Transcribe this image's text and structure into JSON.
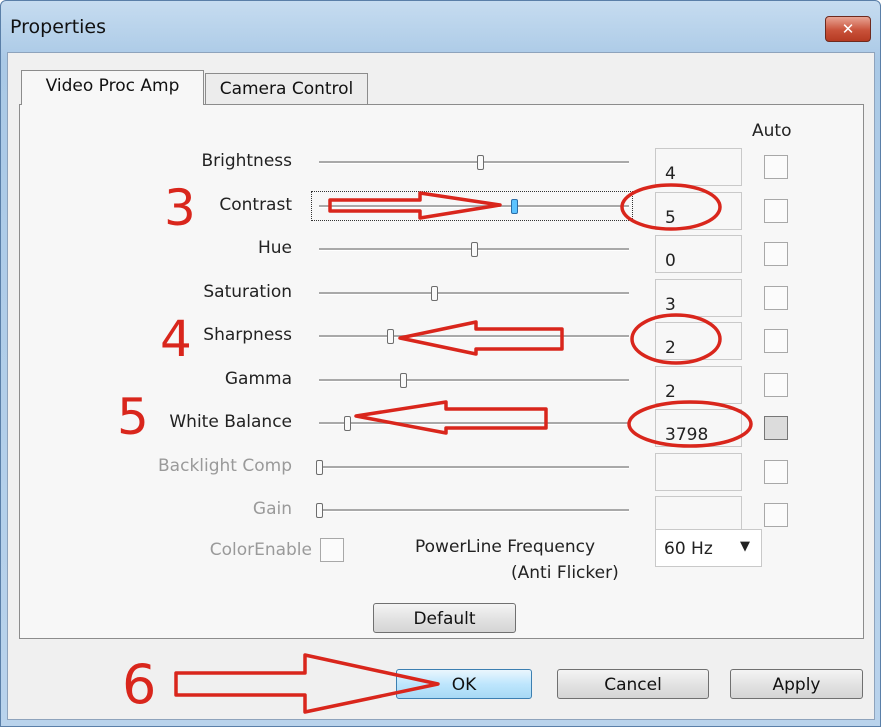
{
  "window": {
    "title": "Properties",
    "close_icon": "close-icon"
  },
  "tabs": [
    {
      "label": "Video Proc Amp",
      "active": true
    },
    {
      "label": "Camera Control",
      "active": false
    }
  ],
  "auto_header": "Auto",
  "properties": [
    {
      "label": "Brightness",
      "value": "4",
      "enabled": true,
      "focused": false,
      "level": 0.52
    },
    {
      "label": "Contrast",
      "value": "5",
      "enabled": true,
      "focused": true,
      "level": 0.63
    },
    {
      "label": "Hue",
      "value": "0",
      "enabled": true,
      "focused": false,
      "level": 0.5
    },
    {
      "label": "Saturation",
      "value": "3",
      "enabled": true,
      "focused": false,
      "level": 0.37
    },
    {
      "label": "Sharpness",
      "value": "2",
      "enabled": true,
      "focused": false,
      "level": 0.23
    },
    {
      "label": "Gamma",
      "value": "2",
      "enabled": true,
      "focused": false,
      "level": 0.27
    },
    {
      "label": "White Balance",
      "value": "3798",
      "enabled": true,
      "focused": false,
      "level": 0.09,
      "auto_dark": true
    },
    {
      "label": "Backlight Comp",
      "value": "",
      "enabled": false,
      "focused": false,
      "level": 0.0
    },
    {
      "label": "Gain",
      "value": "",
      "enabled": false,
      "focused": false,
      "level": 0.0
    }
  ],
  "color_enable": {
    "label": "ColorEnable",
    "checked": false
  },
  "powerline": {
    "label_line1": "PowerLine Frequency",
    "label_line2": "(Anti Flicker)",
    "selected": "60 Hz"
  },
  "buttons": {
    "default": "Default",
    "ok": "OK",
    "cancel": "Cancel",
    "apply": "Apply"
  },
  "annotations": {
    "num3": "3",
    "num4": "4",
    "num5": "5",
    "num6": "6",
    "color": "#d9261c"
  }
}
